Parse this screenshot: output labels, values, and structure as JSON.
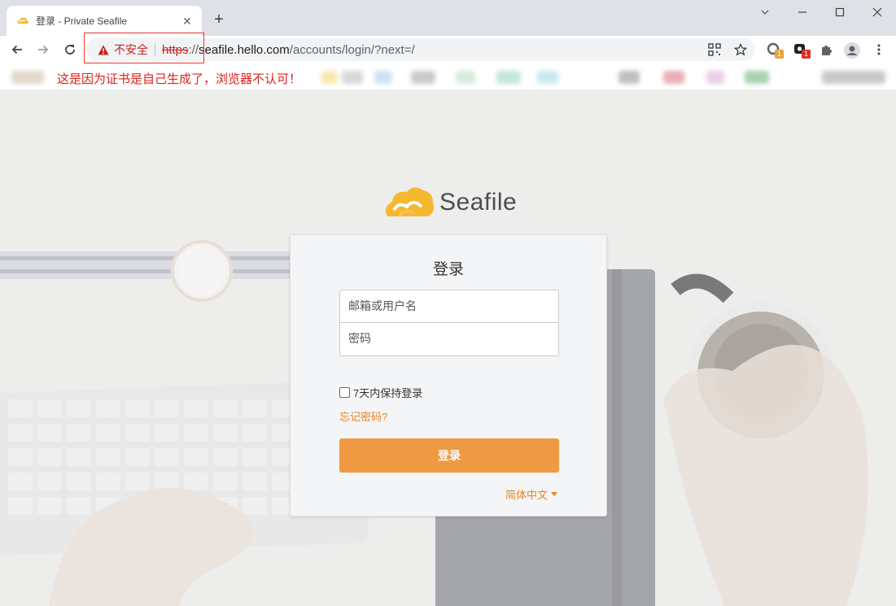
{
  "browser": {
    "tab": {
      "title": "登录 - Private Seafile"
    },
    "address": {
      "security_label": "不安全",
      "url_scheme": "https",
      "url_sep": "://",
      "url_host": "seafile.hello.com",
      "url_path": "/accounts/login/?next=/"
    },
    "extensions": [
      {
        "name": "extension-1-icon",
        "badge": "1",
        "badge_color": "#e8a33a"
      },
      {
        "name": "extension-2-icon",
        "badge": "1",
        "badge_color": "#d93025"
      }
    ]
  },
  "annotation": {
    "note": "这是因为证书是自己生成了，浏览器不认可！",
    "color": "#e0201b"
  },
  "login": {
    "brand": "Seafile",
    "title": "登录",
    "username_placeholder": "邮箱或用户名",
    "password_placeholder": "密码",
    "remember_label": "7天内保持登录",
    "forgot_link": "忘记密码?",
    "submit_label": "登录",
    "language": "简体中文",
    "accent_color": "#f09943"
  }
}
